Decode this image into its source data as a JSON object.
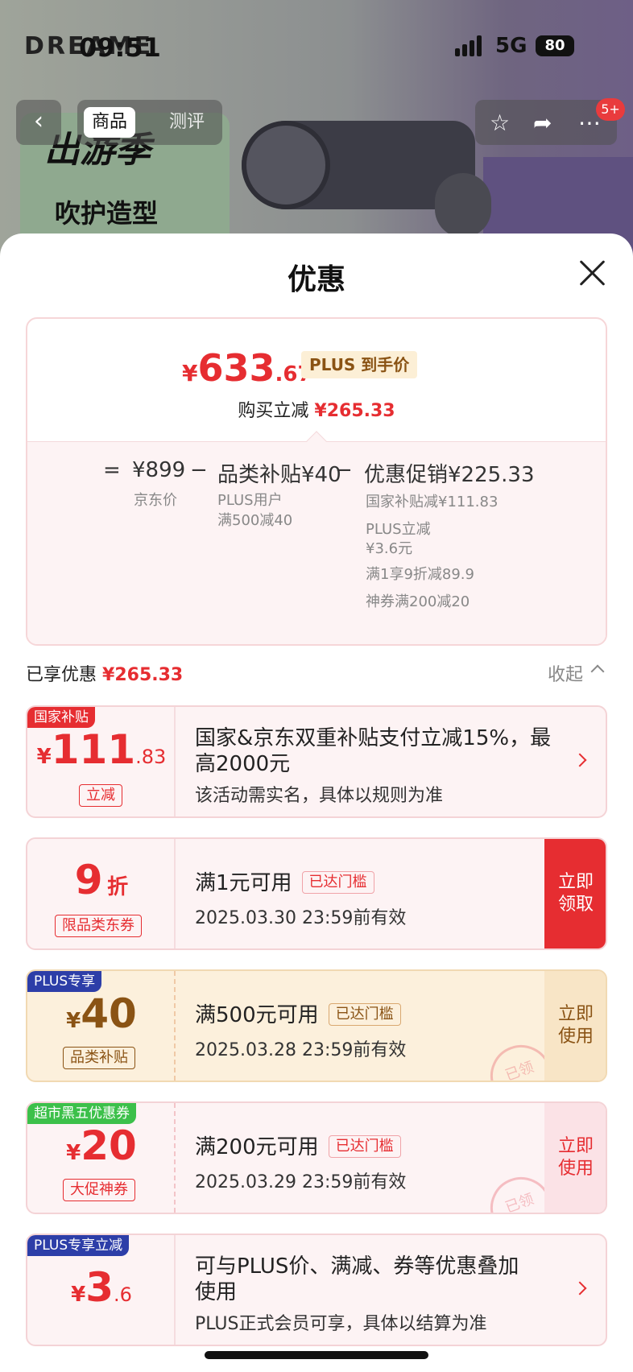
{
  "status_bar": {
    "time": "09:51",
    "network": "5G",
    "battery": "80"
  },
  "background": {
    "brand": "DREAME",
    "poster_line1": "出游季",
    "poster_line2": "吹护造型"
  },
  "top_nav": {
    "tabs": [
      {
        "label": "商品"
      },
      {
        "label": "测评"
      }
    ],
    "badge": "5+"
  },
  "sheet": {
    "title": "优惠",
    "summary": {
      "currency": "¥",
      "price_integer": "633",
      "price_decimal": ".67",
      "price_tag": "PLUS 到手价",
      "instant_label": "购买立减",
      "instant_amount": "¥265.33",
      "equals": "=",
      "minus": "−",
      "jd_price": "¥899",
      "jd_price_label": "京东价",
      "category_subsidy": "品类补贴¥40",
      "category_sub_lines": [
        "PLUS用户",
        "满500减40"
      ],
      "promo_total": "优惠促销¥225.33",
      "promo_lines": [
        "国家补贴减¥111.83",
        "PLUS立减",
        "¥3.6元",
        "满1享9折减89.9",
        "神券满200减20"
      ]
    },
    "enjoyed_label": "已享优惠",
    "enjoyed_amount": "¥265.33",
    "collapse_label": "收起",
    "cards": [
      {
        "corner": "国家补贴",
        "symbol": "¥",
        "big": "111",
        "decimal": ".83",
        "chip": "立减",
        "main": "国家&京东双重补贴支付立减15%，最",
        "main2": "高2000元",
        "sub": "该活动需实名，具体以规则为准"
      },
      {
        "big": "9",
        "unit": "折",
        "chip": "限品类东券",
        "main": "满1元可用",
        "reached": "已达门槛",
        "sub": "2025.03.30 23:59前有效",
        "action": [
          "立即",
          "领取"
        ]
      },
      {
        "corner": "PLUS专享",
        "symbol": "¥",
        "big": "40",
        "chip": "品类补贴",
        "main": "满500元可用",
        "reached": "已达门槛",
        "sub": "2025.03.28 23:59前有效",
        "action": [
          "立即",
          "使用"
        ],
        "stamp": "已领"
      },
      {
        "corner": "超市黑五优惠券",
        "symbol": "¥",
        "big": "20",
        "chip": "大促神券",
        "main": "满200元可用",
        "reached": "已达门槛",
        "sub": "2025.03.29 23:59前有效",
        "action": [
          "立即",
          "使用"
        ],
        "stamp": "已领"
      },
      {
        "corner": "PLUS专享立减",
        "symbol": "¥",
        "big": "3",
        "decimal": ".6",
        "main": "可与PLUS价、满减、券等优惠叠加",
        "main2": "使用",
        "sub": "PLUS正式会员可享，具体以结算为准"
      }
    ]
  },
  "colors": {
    "accent_red": "#e62d31",
    "plus_blue": "#2d3ea8",
    "gold": "#8a5314",
    "green": "#3cc04a"
  }
}
